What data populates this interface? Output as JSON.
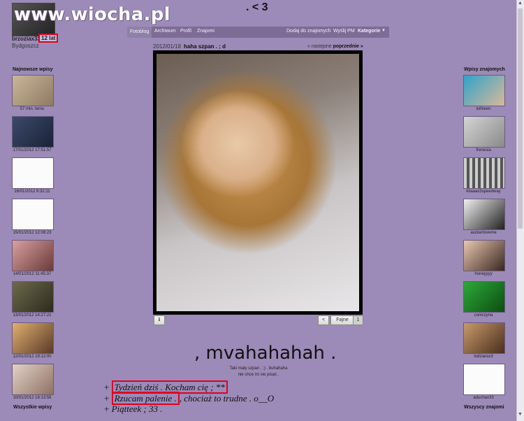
{
  "watermark": "www.wiocha.pl",
  "profile": {
    "username": "brzoziax33",
    "age": "12 lat",
    "city": "Bydgoszcz"
  },
  "top_title": ". < 3",
  "nav": {
    "items": [
      "Fotoblog",
      "Archiwum",
      "Profil",
      "Znajomi"
    ],
    "right": [
      "Dodaj do znajomych",
      "Wyślij PM",
      "Kategorie"
    ]
  },
  "post": {
    "date": "2012/01/18",
    "title": "haha szpan . ; d",
    "prev": "« następne",
    "next": "poprzednie »",
    "like_label": "Fajne",
    "like_count": "1",
    "info_icon": "info-icon",
    "share_icon": "share-icon"
  },
  "caption": {
    "big": ", mvahahahah .",
    "small_1": "Taki mały szpan . ;) . buhahaha",
    "small_2": "nie chce mi sie pisać ."
  },
  "lines": {
    "l1": "Tydzień dziś . Kocham cię ; **",
    "l2a": "Rzucam palenie .",
    "l2b": "chociaż to trudne . o__O",
    "l3": "Piątteek ; 33 ."
  },
  "left": {
    "heading": "Najnowsze wpisy",
    "footer": "Wszystkie wpisy",
    "items": [
      "57 min. temu",
      "17/01/2012 17:51:57",
      "16/01/2012 8:32:11",
      "15/01/2012 12:08:23",
      "14/01/2012 11:45:37",
      "13/01/2012 14:27:21",
      "12/01/2012 19:12:00",
      "10/01/2012 18:13:56"
    ]
  },
  "right": {
    "heading": "Wpisy znajomych",
    "footer": "Wszyscy znajomi",
    "items": [
      "luthieen",
      "frenesia",
      "kitaaax3speedway",
      "auckerloveme",
      "honeyyyy",
      "coniczyna",
      "lodziarax3",
      "aduchax33"
    ]
  },
  "colors": {
    "background": "#9c8ab8",
    "highlight": "#e00020",
    "nav": "#7d6c96"
  }
}
